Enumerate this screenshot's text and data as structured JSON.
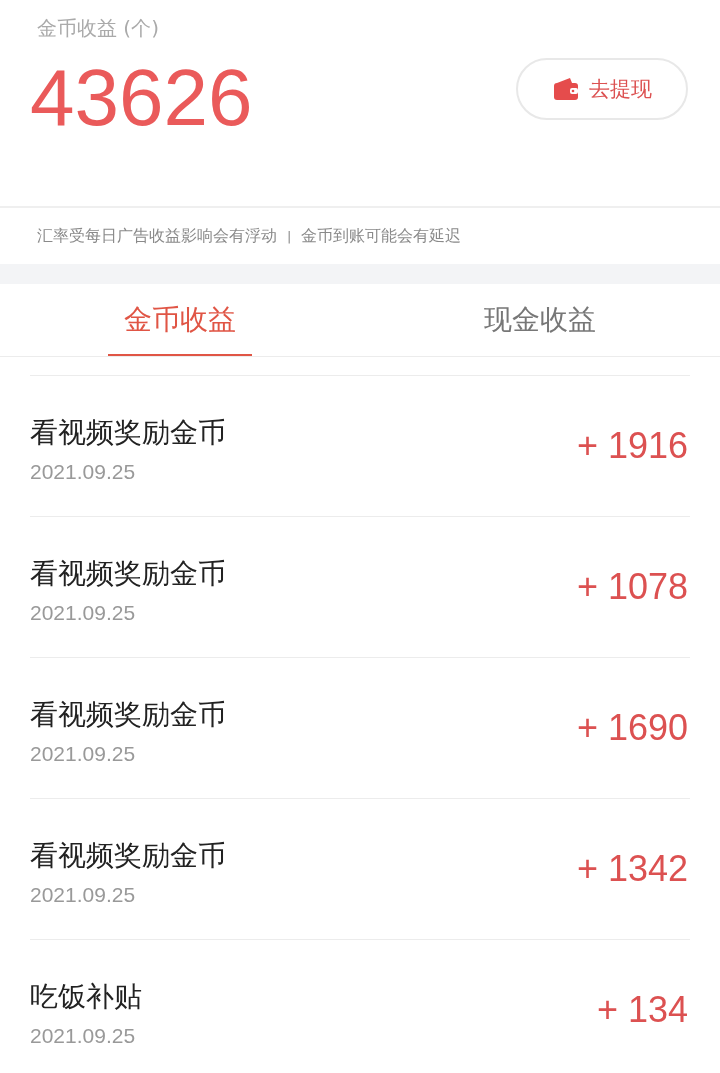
{
  "summary": {
    "label": "金币收益 (个)",
    "total": "43626",
    "withdraw_button": "去提现"
  },
  "notice": {
    "left": "汇率受每日广告收益影响会有浮动",
    "separator": "|",
    "right": "金币到账可能会有延迟"
  },
  "tabs": [
    {
      "label": "金币收益",
      "selected": true
    },
    {
      "label": "现金收益",
      "selected": false
    }
  ],
  "records": [
    {
      "title": "看视频奖励金币",
      "date": "2021.09.25",
      "amount": "+ 1916"
    },
    {
      "title": "看视频奖励金币",
      "date": "2021.09.25",
      "amount": "+ 1078"
    },
    {
      "title": "看视频奖励金币",
      "date": "2021.09.25",
      "amount": "+ 1690"
    },
    {
      "title": "看视频奖励金币",
      "date": "2021.09.25",
      "amount": "+ 1342"
    },
    {
      "title": "吃饭补贴",
      "date": "2021.09.25",
      "amount": "+ 134"
    }
  ]
}
